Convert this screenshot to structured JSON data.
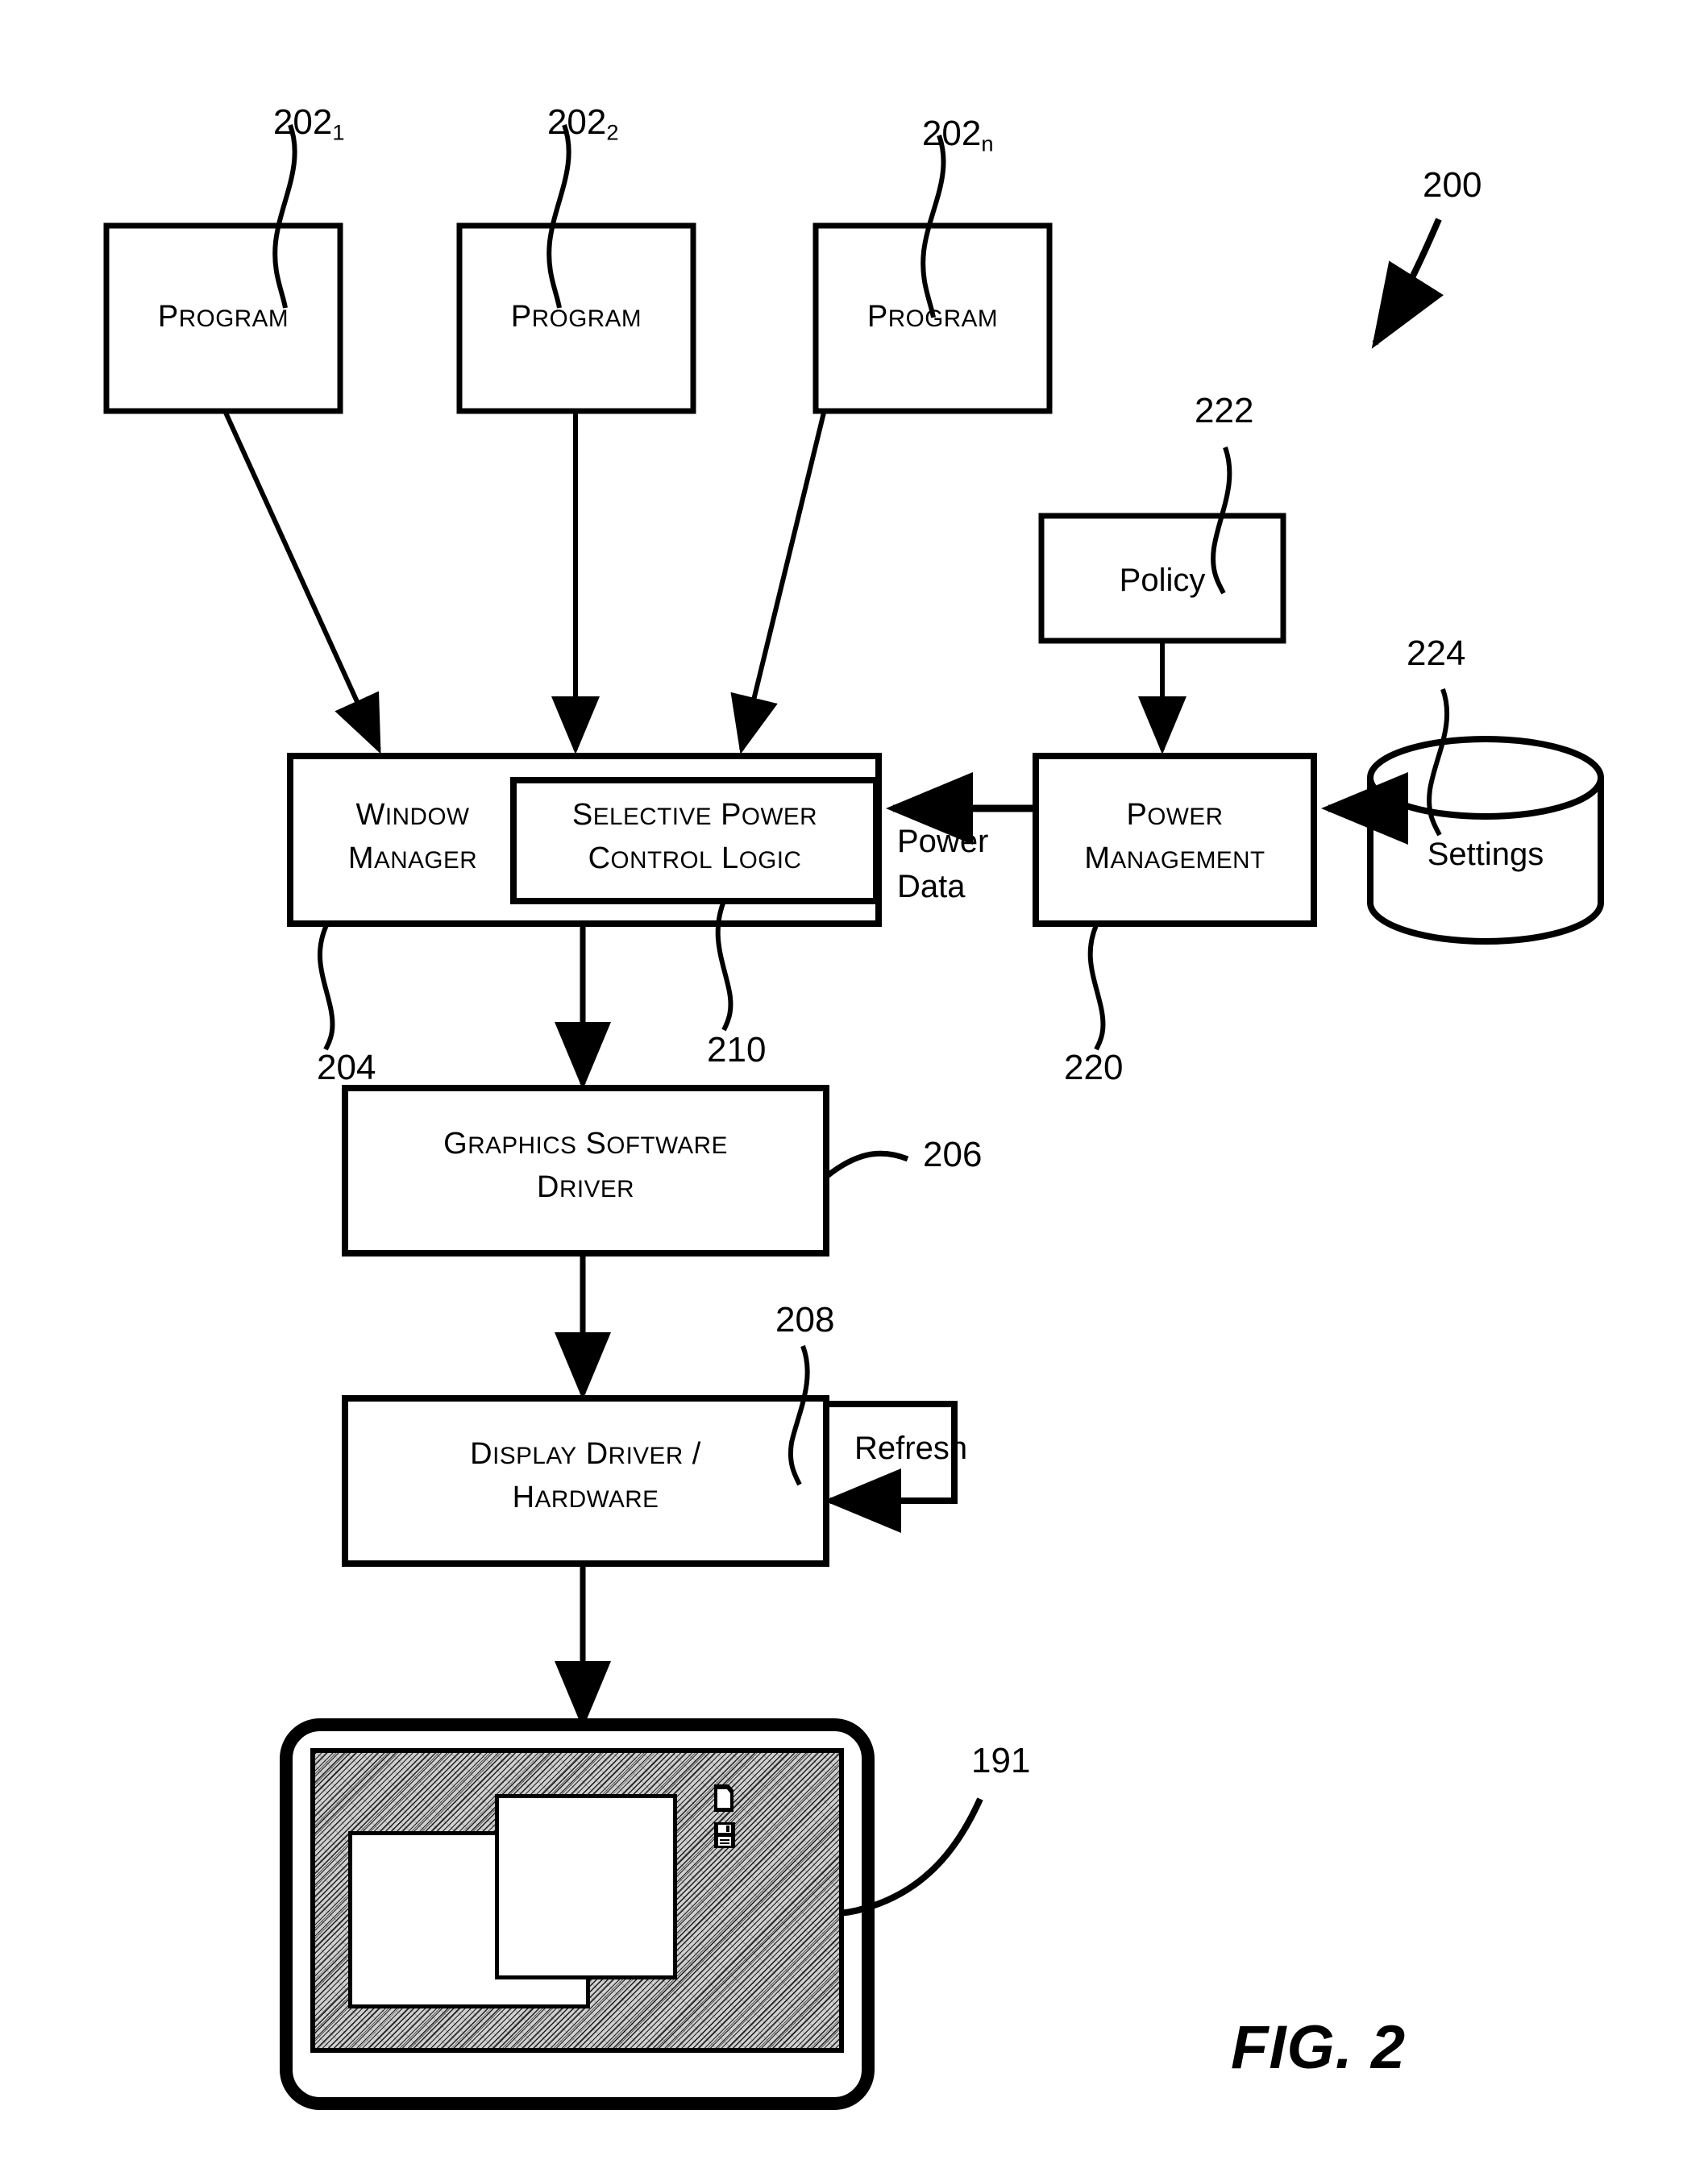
{
  "figure": {
    "caption": "FIG. 2",
    "system_ref": "200"
  },
  "programs": [
    {
      "label": "Program",
      "ref_base": "202",
      "ref_sub": "1"
    },
    {
      "label": "Program",
      "ref_base": "202",
      "ref_sub": "2"
    },
    {
      "label": "Program",
      "ref_base": "202",
      "ref_sub": "n"
    }
  ],
  "blocks": {
    "window_manager": {
      "line1": "Window",
      "line2": "Manager",
      "ref": "204"
    },
    "selective_power_control_logic": {
      "line1": "Selective Power",
      "line2": "Control Logic",
      "ref": "210"
    },
    "power_management": {
      "line1": "Power",
      "line2": "Management",
      "ref": "220"
    },
    "policy": {
      "label": "Policy",
      "ref": "222"
    },
    "settings": {
      "label": "Settings",
      "ref": "224"
    },
    "graphics_software_driver": {
      "line1": "Graphics Software",
      "line2": "Driver",
      "ref": "206"
    },
    "display_driver_hardware": {
      "line1": "Display Driver /",
      "line2": "Hardware",
      "ref": "208"
    },
    "display_device": {
      "ref": "191"
    }
  },
  "edge_labels": {
    "power_data_line1": "Power",
    "power_data_line2": "Data",
    "refresh": "Refresh"
  },
  "display_contents": {
    "window_back": "window-back",
    "window_front": "window-front",
    "icons": [
      "document-icon",
      "floppy-save-icon"
    ]
  },
  "colors": {
    "ink": "#000000",
    "paper": "#ffffff",
    "desktop_fill": "#cfcfcf"
  }
}
